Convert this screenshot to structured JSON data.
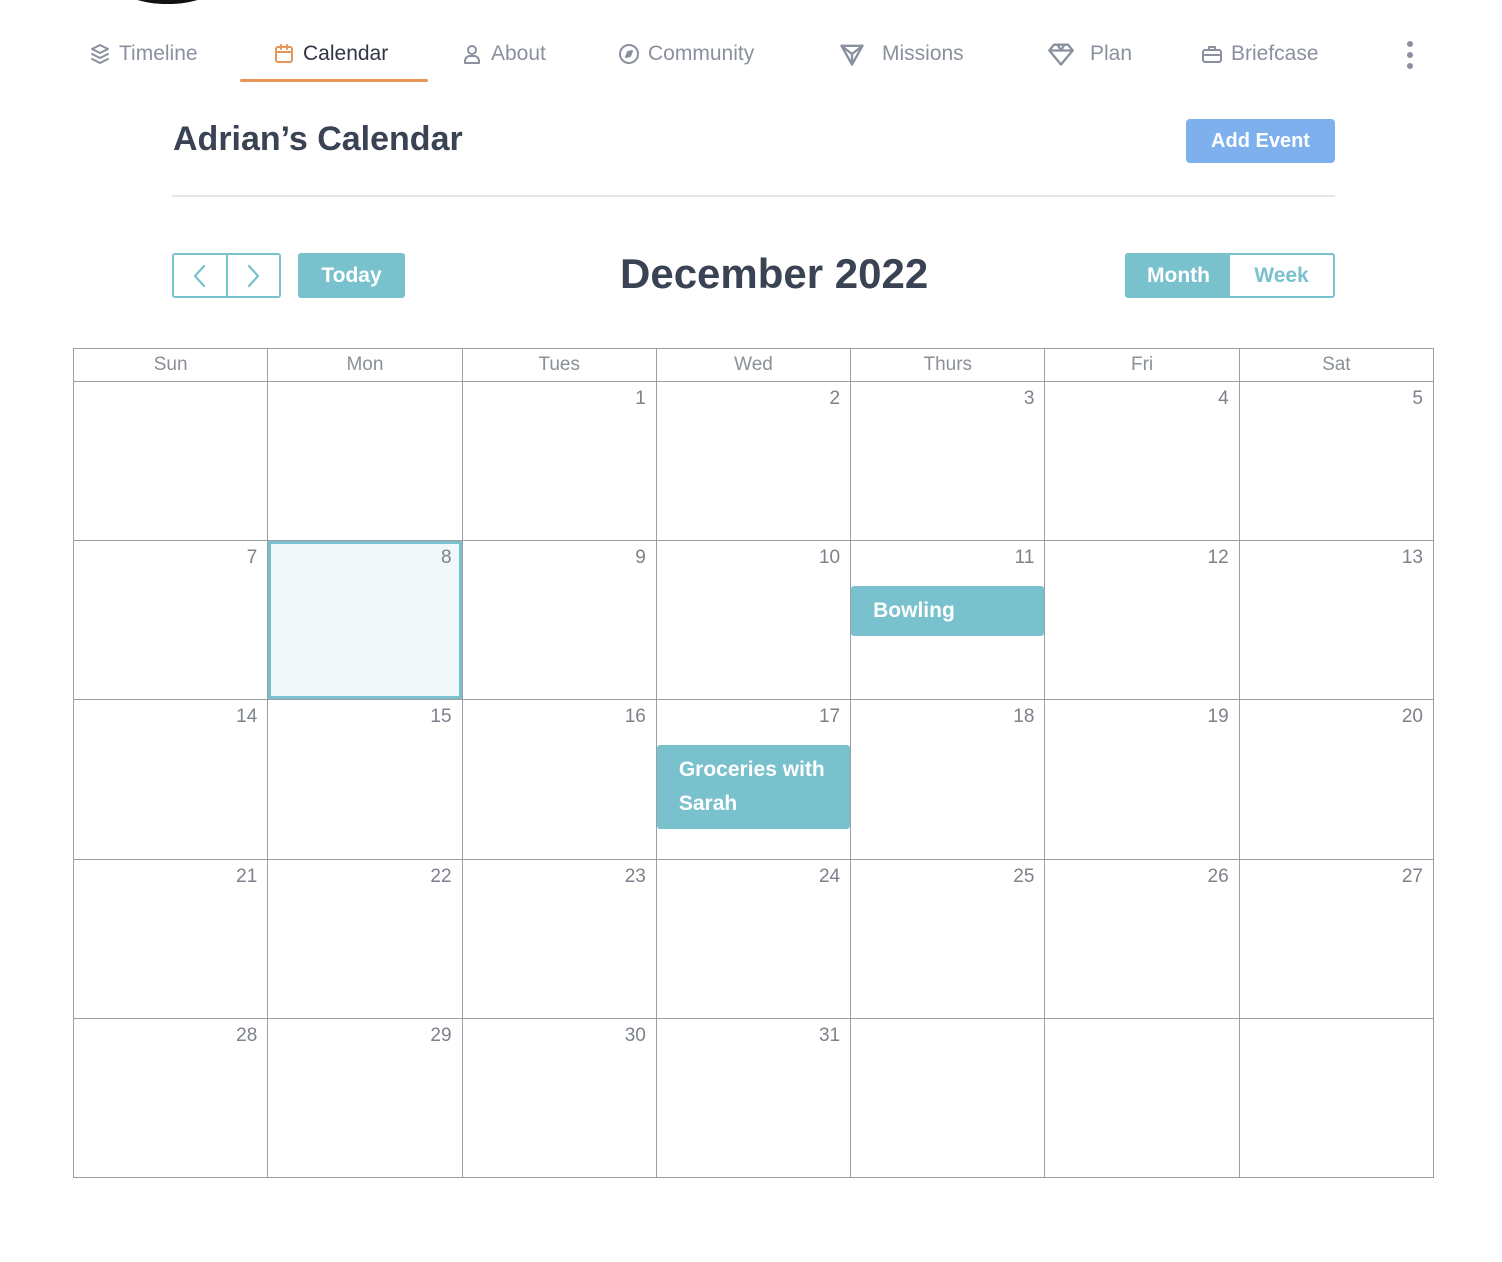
{
  "nav": {
    "items": [
      {
        "label": "Timeline",
        "icon": "layers-icon",
        "active": false
      },
      {
        "label": "Calendar",
        "icon": "calendar-icon",
        "active": true
      },
      {
        "label": "About",
        "icon": "user-icon",
        "active": false
      },
      {
        "label": "Community",
        "icon": "compass-icon",
        "active": false
      },
      {
        "label": "Missions",
        "icon": "triangle-icon",
        "active": false
      },
      {
        "label": "Plan",
        "icon": "diamond-icon",
        "active": false
      },
      {
        "label": "Briefcase",
        "icon": "briefcase-icon",
        "active": false
      }
    ],
    "more_icon": "more-vertical-icon"
  },
  "header": {
    "title": "Adrian’s Calendar",
    "add_event_label": "Add Event"
  },
  "toolbar": {
    "prev_icon": "chevron-left-icon",
    "next_icon": "chevron-right-icon",
    "today_label": "Today",
    "month_title": "December 2022",
    "views": [
      {
        "label": "Month",
        "active": true
      },
      {
        "label": "Week",
        "active": false
      }
    ]
  },
  "calendar": {
    "days_of_week": [
      "Sun",
      "Mon",
      "Tues",
      "Wed",
      "Thurs",
      "Fri",
      "Sat"
    ],
    "weeks": [
      [
        "",
        "",
        "1",
        "2",
        "3",
        "4",
        "5"
      ],
      [
        "7",
        "8",
        "9",
        "10",
        "11",
        "12",
        "13"
      ],
      [
        "14",
        "15",
        "16",
        "17",
        "18",
        "19",
        "20"
      ],
      [
        "21",
        "22",
        "23",
        "24",
        "25",
        "26",
        "27"
      ],
      [
        "28",
        "29",
        "30",
        "31",
        "",
        "",
        ""
      ]
    ],
    "today": "8",
    "events": [
      {
        "day": "11",
        "title": "Bowling"
      },
      {
        "day": "17",
        "title": "Groceries with Sarah"
      }
    ],
    "accent_color": "#79c1cd"
  }
}
